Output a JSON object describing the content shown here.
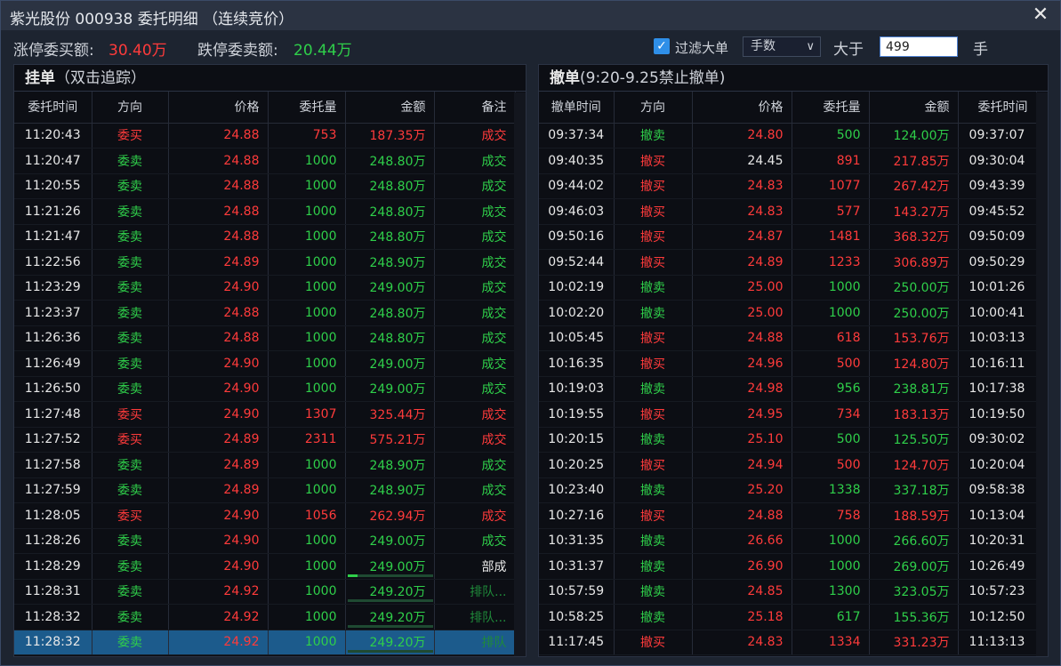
{
  "window": {
    "title": "紫光股份 000938 委托明细 （连续竞价）",
    "close_icon": "close-icon"
  },
  "info": {
    "limit_up_label": "涨停委买额:",
    "limit_up_value": "30.40万",
    "limit_down_label": "跌停委卖额:",
    "limit_down_value": "20.44万",
    "filter_label": "过滤大单",
    "filter_checked": true,
    "unit_select": "手数",
    "greater_label": "大于",
    "threshold_value": "499",
    "unit_label": "手"
  },
  "colors": {
    "up": "#ff3b3b",
    "down": "#2fcf4a",
    "neutral": "#e8e8e8",
    "selected": "#1c5b8c"
  },
  "left_panel": {
    "title": "挂单",
    "subtitle": "（双击追踪）",
    "headers": [
      "委托时间",
      "方向",
      "价格",
      "委托量",
      "金额",
      "备注"
    ],
    "rows": [
      {
        "time": "11:20:43",
        "dir": "委买",
        "price": "24.88",
        "qty": "753",
        "amount": "187.35万",
        "note": "成交",
        "tone": "red"
      },
      {
        "time": "11:20:47",
        "dir": "委卖",
        "price": "24.88",
        "qty": "1000",
        "amount": "248.80万",
        "note": "成交",
        "tone": "green"
      },
      {
        "time": "11:20:55",
        "dir": "委卖",
        "price": "24.88",
        "qty": "1000",
        "amount": "248.80万",
        "note": "成交",
        "tone": "green"
      },
      {
        "time": "11:21:26",
        "dir": "委卖",
        "price": "24.88",
        "qty": "1000",
        "amount": "248.80万",
        "note": "成交",
        "tone": "green"
      },
      {
        "time": "11:21:47",
        "dir": "委卖",
        "price": "24.88",
        "qty": "1000",
        "amount": "248.80万",
        "note": "成交",
        "tone": "green"
      },
      {
        "time": "11:22:56",
        "dir": "委卖",
        "price": "24.89",
        "qty": "1000",
        "amount": "248.90万",
        "note": "成交",
        "tone": "green"
      },
      {
        "time": "11:23:29",
        "dir": "委卖",
        "price": "24.90",
        "qty": "1000",
        "amount": "249.00万",
        "note": "成交",
        "tone": "green"
      },
      {
        "time": "11:23:37",
        "dir": "委卖",
        "price": "24.88",
        "qty": "1000",
        "amount": "248.80万",
        "note": "成交",
        "tone": "green"
      },
      {
        "time": "11:26:36",
        "dir": "委卖",
        "price": "24.88",
        "qty": "1000",
        "amount": "248.80万",
        "note": "成交",
        "tone": "green"
      },
      {
        "time": "11:26:49",
        "dir": "委卖",
        "price": "24.90",
        "qty": "1000",
        "amount": "249.00万",
        "note": "成交",
        "tone": "green"
      },
      {
        "time": "11:26:50",
        "dir": "委卖",
        "price": "24.90",
        "qty": "1000",
        "amount": "249.00万",
        "note": "成交",
        "tone": "green"
      },
      {
        "time": "11:27:48",
        "dir": "委买",
        "price": "24.90",
        "qty": "1307",
        "amount": "325.44万",
        "note": "成交",
        "tone": "red"
      },
      {
        "time": "11:27:52",
        "dir": "委买",
        "price": "24.89",
        "qty": "2311",
        "amount": "575.21万",
        "note": "成交",
        "tone": "red"
      },
      {
        "time": "11:27:58",
        "dir": "委卖",
        "price": "24.89",
        "qty": "1000",
        "amount": "248.90万",
        "note": "成交",
        "tone": "green"
      },
      {
        "time": "11:27:59",
        "dir": "委卖",
        "price": "24.89",
        "qty": "1000",
        "amount": "248.90万",
        "note": "成交",
        "tone": "green"
      },
      {
        "time": "11:28:05",
        "dir": "委买",
        "price": "24.90",
        "qty": "1056",
        "amount": "262.94万",
        "note": "成交",
        "tone": "red"
      },
      {
        "time": "11:28:26",
        "dir": "委卖",
        "price": "24.90",
        "qty": "1000",
        "amount": "249.00万",
        "note": "成交",
        "tone": "green"
      },
      {
        "time": "11:28:29",
        "dir": "委卖",
        "price": "24.90",
        "qty": "1000",
        "amount": "249.00万",
        "note": "部成",
        "tone": "green",
        "progress": 0.12
      },
      {
        "time": "11:28:31",
        "dir": "委卖",
        "price": "24.92",
        "qty": "1000",
        "amount": "249.20万",
        "note": "排队...",
        "tone": "green",
        "progress": 0.0
      },
      {
        "time": "11:28:32",
        "dir": "委卖",
        "price": "24.92",
        "qty": "1000",
        "amount": "249.20万",
        "note": "排队...",
        "tone": "green",
        "progress": 0.0
      },
      {
        "time": "11:28:32",
        "dir": "委卖",
        "price": "24.92",
        "qty": "1000",
        "amount": "249.20万",
        "note": "排队",
        "tone": "green",
        "progress": 0.0,
        "selected": true
      }
    ]
  },
  "right_panel": {
    "title": "撤单",
    "subtitle": "(9:20-9.25禁止撤单)",
    "headers": [
      "撤单时间",
      "方向",
      "价格",
      "委托量",
      "金额",
      "委托时间"
    ],
    "rows": [
      {
        "time": "09:37:34",
        "dir": "撤卖",
        "price": "24.80",
        "qty": "500",
        "amount": "124.00万",
        "otime": "09:37:07",
        "tone": "green",
        "price_tone": "red"
      },
      {
        "time": "09:40:35",
        "dir": "撤买",
        "price": "24.45",
        "qty": "891",
        "amount": "217.85万",
        "otime": "09:30:04",
        "tone": "red",
        "price_tone": "white"
      },
      {
        "time": "09:44:02",
        "dir": "撤买",
        "price": "24.83",
        "qty": "1077",
        "amount": "267.42万",
        "otime": "09:43:39",
        "tone": "red",
        "price_tone": "red"
      },
      {
        "time": "09:46:03",
        "dir": "撤买",
        "price": "24.83",
        "qty": "577",
        "amount": "143.27万",
        "otime": "09:45:52",
        "tone": "red",
        "price_tone": "red"
      },
      {
        "time": "09:50:16",
        "dir": "撤买",
        "price": "24.87",
        "qty": "1481",
        "amount": "368.32万",
        "otime": "09:50:09",
        "tone": "red",
        "price_tone": "red"
      },
      {
        "time": "09:52:44",
        "dir": "撤买",
        "price": "24.89",
        "qty": "1233",
        "amount": "306.89万",
        "otime": "09:50:29",
        "tone": "red",
        "price_tone": "red"
      },
      {
        "time": "10:02:19",
        "dir": "撤卖",
        "price": "25.00",
        "qty": "1000",
        "amount": "250.00万",
        "otime": "10:01:26",
        "tone": "green",
        "price_tone": "red"
      },
      {
        "time": "10:02:20",
        "dir": "撤卖",
        "price": "25.00",
        "qty": "1000",
        "amount": "250.00万",
        "otime": "10:00:41",
        "tone": "green",
        "price_tone": "red"
      },
      {
        "time": "10:05:45",
        "dir": "撤买",
        "price": "24.88",
        "qty": "618",
        "amount": "153.76万",
        "otime": "10:03:13",
        "tone": "red",
        "price_tone": "red"
      },
      {
        "time": "10:16:35",
        "dir": "撤买",
        "price": "24.96",
        "qty": "500",
        "amount": "124.80万",
        "otime": "10:16:11",
        "tone": "red",
        "price_tone": "red"
      },
      {
        "time": "10:19:03",
        "dir": "撤卖",
        "price": "24.98",
        "qty": "956",
        "amount": "238.81万",
        "otime": "10:17:38",
        "tone": "green",
        "price_tone": "red"
      },
      {
        "time": "10:19:55",
        "dir": "撤买",
        "price": "24.95",
        "qty": "734",
        "amount": "183.13万",
        "otime": "10:19:50",
        "tone": "red",
        "price_tone": "red"
      },
      {
        "time": "10:20:15",
        "dir": "撤卖",
        "price": "25.10",
        "qty": "500",
        "amount": "125.50万",
        "otime": "09:30:02",
        "tone": "green",
        "price_tone": "red"
      },
      {
        "time": "10:20:25",
        "dir": "撤买",
        "price": "24.94",
        "qty": "500",
        "amount": "124.70万",
        "otime": "10:20:04",
        "tone": "red",
        "price_tone": "red"
      },
      {
        "time": "10:23:40",
        "dir": "撤卖",
        "price": "25.20",
        "qty": "1338",
        "amount": "337.18万",
        "otime": "09:58:38",
        "tone": "green",
        "price_tone": "red"
      },
      {
        "time": "10:27:16",
        "dir": "撤买",
        "price": "24.88",
        "qty": "758",
        "amount": "188.59万",
        "otime": "10:13:04",
        "tone": "red",
        "price_tone": "red"
      },
      {
        "time": "10:31:35",
        "dir": "撤卖",
        "price": "26.66",
        "qty": "1000",
        "amount": "266.60万",
        "otime": "10:20:31",
        "tone": "green",
        "price_tone": "red"
      },
      {
        "time": "10:31:37",
        "dir": "撤卖",
        "price": "26.90",
        "qty": "1000",
        "amount": "269.00万",
        "otime": "10:26:49",
        "tone": "green",
        "price_tone": "red"
      },
      {
        "time": "10:57:59",
        "dir": "撤卖",
        "price": "24.85",
        "qty": "1300",
        "amount": "323.05万",
        "otime": "10:57:23",
        "tone": "green",
        "price_tone": "red"
      },
      {
        "time": "10:58:25",
        "dir": "撤卖",
        "price": "25.18",
        "qty": "617",
        "amount": "155.36万",
        "otime": "10:12:50",
        "tone": "green",
        "price_tone": "red"
      },
      {
        "time": "11:17:45",
        "dir": "撤买",
        "price": "24.83",
        "qty": "1334",
        "amount": "331.23万",
        "otime": "11:13:13",
        "tone": "red",
        "price_tone": "red"
      }
    ]
  }
}
